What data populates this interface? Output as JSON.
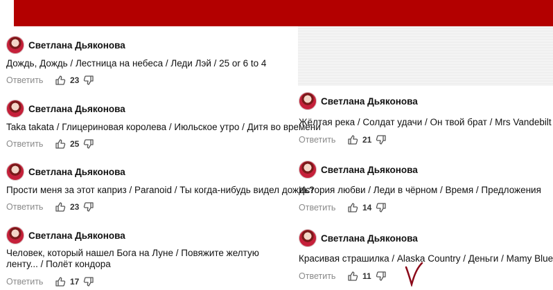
{
  "reply_label": "Ответить",
  "colors": {
    "banner": "#b30000",
    "accent_mark": "#8b0a1a"
  },
  "icons": {
    "like": "thumbs-up-icon",
    "dislike": "thumbs-down-icon",
    "avatar": "avatar"
  },
  "comments_left": [
    {
      "author": "Светлана Дьяконова",
      "text": "Дождь, Дождь / Лестница на небеса / Леди Лэй / 25 or 6 to 4",
      "likes": "23"
    },
    {
      "author": "Светлана Дьяконова",
      "text": "Taka takata / Глицериновая королева / Июльское утро / Дитя во времени",
      "likes": "25"
    },
    {
      "author": "Светлана Дьяконова",
      "text": "Прости меня за этот каприз / Paranoid / Ты когда-нибудь видел дождь?",
      "likes": "23"
    },
    {
      "author": "Светлана Дьяконова",
      "text": "Человек, который нашел Бога на Луне / Повяжите желтую ленту... / Полёт кондора",
      "likes": "17"
    }
  ],
  "comments_right": [
    {
      "author": "Светлана Дьяконова",
      "text": "Жёлтая река / Солдат удачи / Он твой брат / Mrs Vandebilt",
      "likes": "21"
    },
    {
      "author": "Светлана Дьяконова",
      "text": "История любви / Леди в чёрном / Время / Предложения",
      "likes": "14"
    },
    {
      "author": "Светлана Дьяконова",
      "text": "Красивая страшилка / Alaska Country / Деньги / Mamy Blue",
      "likes": "11"
    }
  ]
}
